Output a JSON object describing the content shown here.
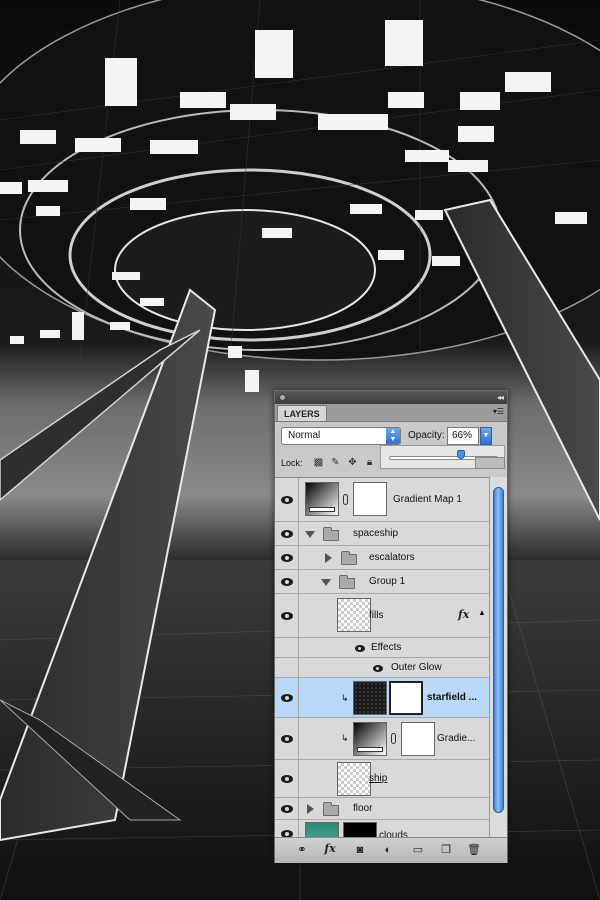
{
  "panel": {
    "tab_label": "LAYERS",
    "blend_mode": "Normal",
    "opacity_label": "Opacity:",
    "opacity_value": "66%",
    "opacity_fraction": 0.66,
    "lock_label": "Lock:"
  },
  "layers": [
    {
      "name": "Gradient Map 1"
    },
    {
      "name": "spaceship"
    },
    {
      "name": "escalators"
    },
    {
      "name": "Group 1"
    },
    {
      "name": "fills"
    },
    {
      "name": "Effects"
    },
    {
      "name": "Outer Glow"
    },
    {
      "name": "starfield ..."
    },
    {
      "name": "Gradie..."
    },
    {
      "name": "ship"
    },
    {
      "name": "floor"
    },
    {
      "name": "clouds"
    }
  ],
  "icons": {
    "fx_glyph": "fx"
  },
  "colors": {
    "selection": "#b9d7f8",
    "accent_blue": "#3d7fd8"
  }
}
